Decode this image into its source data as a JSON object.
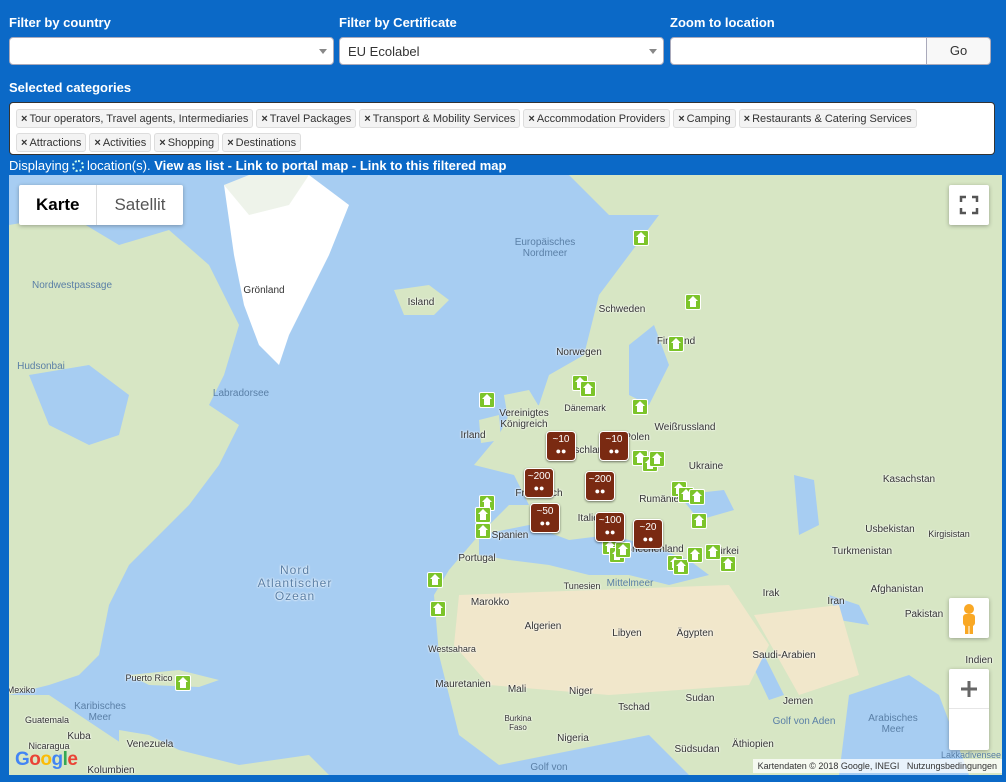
{
  "filters": {
    "country_label": "Filter by country",
    "country_value": "",
    "certificate_label": "Filter by Certificate",
    "certificate_value": "EU Ecolabel",
    "zoom_label": "Zoom to location",
    "zoom_value": "",
    "go_label": "Go"
  },
  "categories": {
    "label": "Selected categories",
    "remove_glyph": "×",
    "items": [
      "Tour operators, Travel agents, Intermediaries",
      "Travel Packages",
      "Transport & Mobility Services",
      "Accommodation Providers",
      "Camping",
      "Restaurants & Catering Services",
      "Attractions",
      "Activities",
      "Shopping",
      "Destinations"
    ]
  },
  "status": {
    "prefix": "Displaying",
    "suffix": "location(s).",
    "view_list": "View as list",
    "sep": " - ",
    "portal_map": "Link to portal map",
    "filtered_map": "Link to this filtered map"
  },
  "map": {
    "type_map": "Karte",
    "type_satellite": "Satellit",
    "attribution": "Kartendaten © 2018 Google, INEGI",
    "terms": "Nutzungsbedingungen",
    "logo": "Google",
    "colors": {
      "water": "#a7cdf2",
      "land": "#d7e6c4",
      "desert": "#f1e7cb",
      "ice": "#ffffff",
      "marker_green": "#7cc42a",
      "cluster": "#7a2a12"
    },
    "labels": {
      "groenland": "Grönland",
      "island": "Island",
      "norwegen": "Norwegen",
      "schweden": "Schweden",
      "finnland": "Finnland",
      "daenemark": "Dänemark",
      "uk": "Vereinigtes Königreich",
      "irland": "Irland",
      "weissrussland": "Weißrussland",
      "polen": "Polen",
      "ukraine": "Ukraine",
      "deutschland": "Deutschland",
      "frankreich": "Frankreich",
      "italien": "Italien",
      "rumaenien": "Rumänien",
      "spanien": "Spanien",
      "portugal": "Portugal",
      "griechenland": "Griechenland",
      "tuerkei": "Türkei",
      "kasachstan": "Kasachstan",
      "usbekistan": "Usbekistan",
      "turkmenistan": "Turkmenistan",
      "kirgisistan": "Kirgisistan",
      "afghanistan": "Afghanistan",
      "pakistan": "Pakistan",
      "indien": "Indien",
      "iran": "Iran",
      "irak": "Irak",
      "saudi": "Saudi-Arabien",
      "jemen": "Jemen",
      "aegypten": "Ägypten",
      "libyen": "Libyen",
      "algerien": "Algerien",
      "tunesien": "Tunesien",
      "marokko": "Marokko",
      "westsahara": "Westsahara",
      "mauretanien": "Mauretanien",
      "mali": "Mali",
      "niger": "Niger",
      "tschad": "Tschad",
      "sudan": "Sudan",
      "suedsudan": "Südsudan",
      "aethiopien": "Äthiopien",
      "nigeria": "Nigeria",
      "burkina": "Burkina Faso",
      "kuba": "Kuba",
      "mexiko": "Mexiko",
      "puerto": "Puerto Rico",
      "venezuela": "Venezuela",
      "kolumbien": "Kolumbien",
      "guatemala": "Guatemala",
      "nicaragua": "Nicaragua",
      "hudsonbai": "Hudsonbai",
      "nordwestpassage": "Nordwestpassage",
      "labradorsee": "Labradorsee",
      "europ_nordmeer": "Europäisches Nordmeer",
      "mittelmeer": "Mittelmeer",
      "karib_meer": "Karibisches Meer",
      "golf_aden": "Golf von Aden",
      "arab_meer": "Arabisches Meer",
      "lakkadiven": "Lakkadivensee",
      "golf": "Golf von",
      "nordatlantik": "Nord Atlantischer Ozean"
    },
    "clusters": [
      "~10",
      "~10",
      "~200",
      "~200",
      "~50",
      "~100",
      "~20"
    ]
  }
}
